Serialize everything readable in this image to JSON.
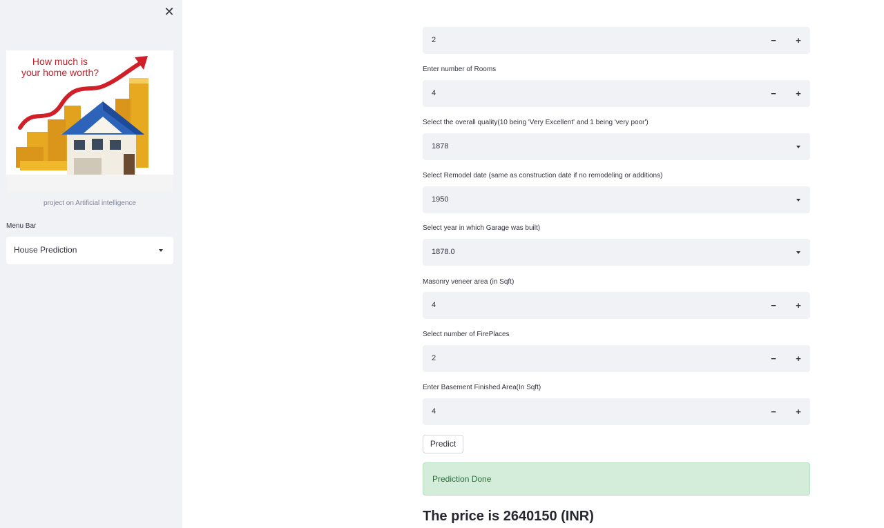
{
  "sidebar": {
    "image_text_line1": "How much is",
    "image_text_line2": "your home worth?",
    "caption": "project on Artificial intelligence",
    "menu_label": "Menu Bar",
    "menu_value": "House Prediction"
  },
  "form": {
    "top_value": "2",
    "rooms_label": "Enter number of Rooms",
    "rooms_value": "4",
    "quality_label": "Select the overall quality(10 being 'Very Excellent' and 1 being 'very poor')",
    "quality_value": "1878",
    "remodel_label": "Select Remodel date (same as construction date if no remodeling or additions)",
    "remodel_value": "1950",
    "garage_label": "Select year in which Garage was built)",
    "garage_value": "1878.0",
    "masonry_label": "Masonry veneer area (in Sqft)",
    "masonry_value": "4",
    "fireplaces_label": "Select number of FirePlaces",
    "fireplaces_value": "2",
    "basement_label": "Enter Basement Finished Area(In Sqft)",
    "basement_value": "4",
    "minus_symbol": "−",
    "plus_symbol": "+"
  },
  "predict_button": "Predict",
  "success_message": "Prediction Done",
  "result_text": "The price is 2640150 (INR)",
  "colors": {
    "sidebar_bg": "#f0f2f6",
    "input_bg": "#f0f2f6",
    "success_bg": "#d4edda",
    "success_text": "#2b6b3a"
  }
}
